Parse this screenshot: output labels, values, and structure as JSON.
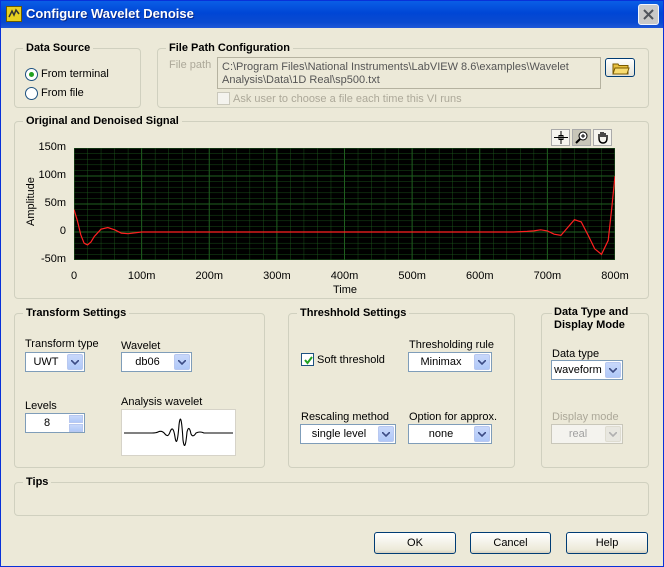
{
  "window": {
    "title": "Configure Wavelet Denoise"
  },
  "data_source": {
    "title": "Data Source",
    "options": [
      {
        "label": "From terminal",
        "selected": true
      },
      {
        "label": "From file",
        "selected": false
      }
    ]
  },
  "file_path": {
    "title": "File Path Configuration",
    "label": "File path",
    "value_line1": "C:\\Program Files\\National Instruments\\LabVIEW 8.6\\examples\\Wavelet",
    "value_line2": "Analysis\\Data\\1D Real\\sp500.txt",
    "ask_user_label": "Ask user to choose a file each time this VI runs",
    "ask_user_checked": false
  },
  "signal_graph": {
    "title": "Original and Denoised Signal",
    "tools": [
      "cursor-tool-icon",
      "zoom-tool-icon",
      "pan-tool-icon"
    ]
  },
  "chart_data": {
    "type": "line",
    "title": "Original and Denoised Signal",
    "xlabel": "Time",
    "ylabel": "Amplitude",
    "xlim": [
      0,
      0.8
    ],
    "ylim": [
      -0.05,
      0.15
    ],
    "x_tick_labels": [
      "0",
      "100m",
      "200m",
      "300m",
      "400m",
      "500m",
      "600m",
      "700m",
      "800m"
    ],
    "y_tick_labels": [
      "150m",
      "100m",
      "50m",
      "0",
      "-50m"
    ],
    "grid": true,
    "colors": {
      "background": "#000000",
      "grid": "#1f5f1f",
      "denoised": "#ff2020",
      "original": "#ffffff"
    },
    "series": [
      {
        "color": "#ff2020",
        "x": [
          0,
          0.005,
          0.01,
          0.015,
          0.02,
          0.025,
          0.03,
          0.04,
          0.05,
          0.06,
          0.07,
          0.08,
          0.1,
          0.15,
          0.2,
          0.3,
          0.4,
          0.5,
          0.6,
          0.65,
          0.67,
          0.68,
          0.69,
          0.7,
          0.71,
          0.72,
          0.73,
          0.74,
          0.75,
          0.76,
          0.77,
          0.78,
          0.79,
          0.795,
          0.8
        ],
        "y": [
          0.04,
          0.02,
          -0.005,
          -0.02,
          -0.023,
          -0.018,
          -0.008,
          0.005,
          0.008,
          0.004,
          -0.002,
          -0.003,
          0,
          0,
          0,
          0,
          0,
          0,
          0,
          0,
          0.001,
          0.002,
          0.004,
          0.002,
          -0.004,
          -0.006,
          0.008,
          0.022,
          0.018,
          -0.005,
          -0.03,
          -0.04,
          -0.015,
          0.04,
          0.1
        ]
      }
    ]
  },
  "transform_settings": {
    "title": "Transform Settings",
    "type_label": "Transform type",
    "type_value": "UWT",
    "wavelet_label": "Wavelet",
    "wavelet_value": "db06",
    "levels_label": "Levels",
    "levels_value": "8",
    "analysis_label": "Analysis wavelet"
  },
  "threshold_settings": {
    "title": "Threshhold Settings",
    "soft_label": "Soft threshold",
    "soft_checked": true,
    "rule_label": "Thresholding rule",
    "rule_value": "Minimax",
    "rescaling_label": "Rescaling method",
    "rescaling_value": "single level",
    "approx_label": "Option for approx.",
    "approx_value": "none"
  },
  "data_type": {
    "title_line1": "Data Type and",
    "title_line2": "Display Mode",
    "type_label": "Data type",
    "type_value": "waveform",
    "mode_label": "Display mode",
    "mode_value": "real"
  },
  "tips": {
    "title": "Tips"
  },
  "buttons": {
    "ok": "OK",
    "cancel": "Cancel",
    "help": "Help"
  }
}
